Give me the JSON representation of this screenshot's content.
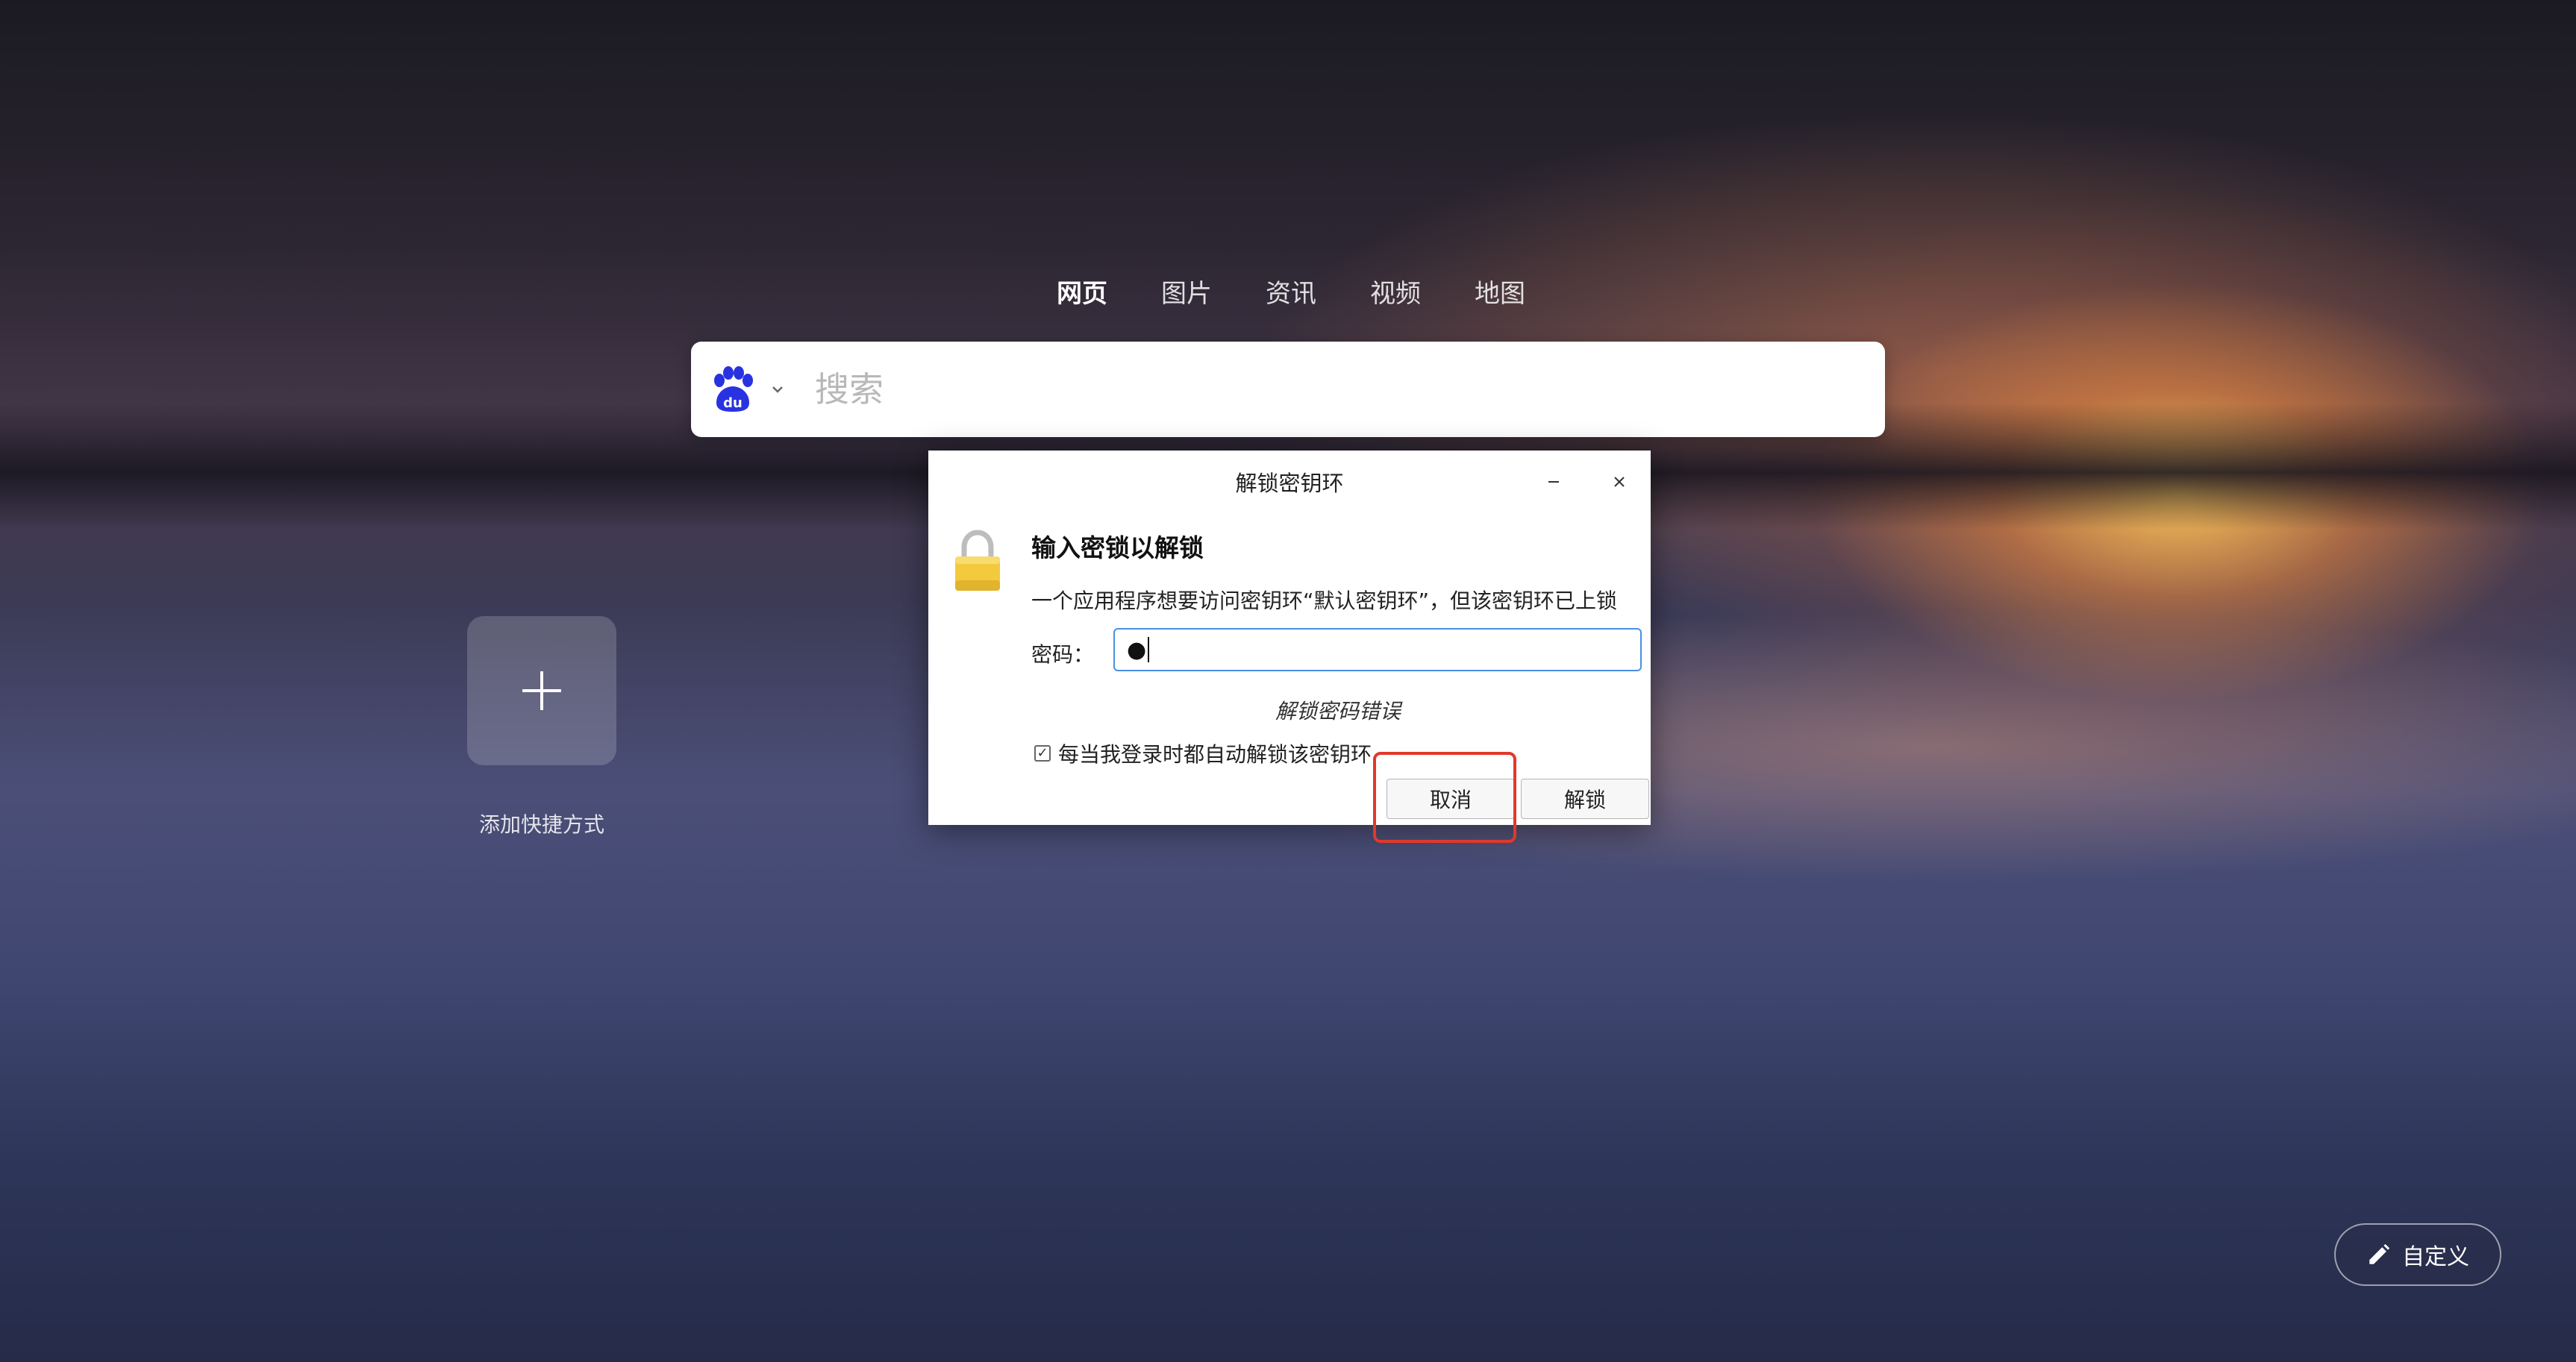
{
  "nav_tabs": [
    {
      "label": "网页",
      "active": true
    },
    {
      "label": "图片",
      "active": false
    },
    {
      "label": "资讯",
      "active": false
    },
    {
      "label": "视频",
      "active": false
    },
    {
      "label": "地图",
      "active": false
    }
  ],
  "search": {
    "engine_icon": "baidu-paw-icon",
    "placeholder": "搜索",
    "value": ""
  },
  "shortcut": {
    "icon": "plus-icon",
    "label": "添加快捷方式"
  },
  "customize": {
    "icon": "pencil-icon",
    "label": "自定义"
  },
  "dialog": {
    "title": "解锁密钥环",
    "heading": "输入密锁以解锁",
    "description": "一个应用程序想要访问密钥环“默认密钥环”，但该密钥环已上锁",
    "password_label": "密码：",
    "password_value": "●",
    "error_text": "解锁密码错误",
    "auto_unlock_label": "每当我登录时都自动解锁该密钥环",
    "auto_unlock_checked": true,
    "cancel_label": "取消",
    "unlock_label": "解锁"
  },
  "colors": {
    "accent_focus": "#4a90e2",
    "highlight": "#e0392b",
    "baidu_blue": "#2932e1"
  }
}
